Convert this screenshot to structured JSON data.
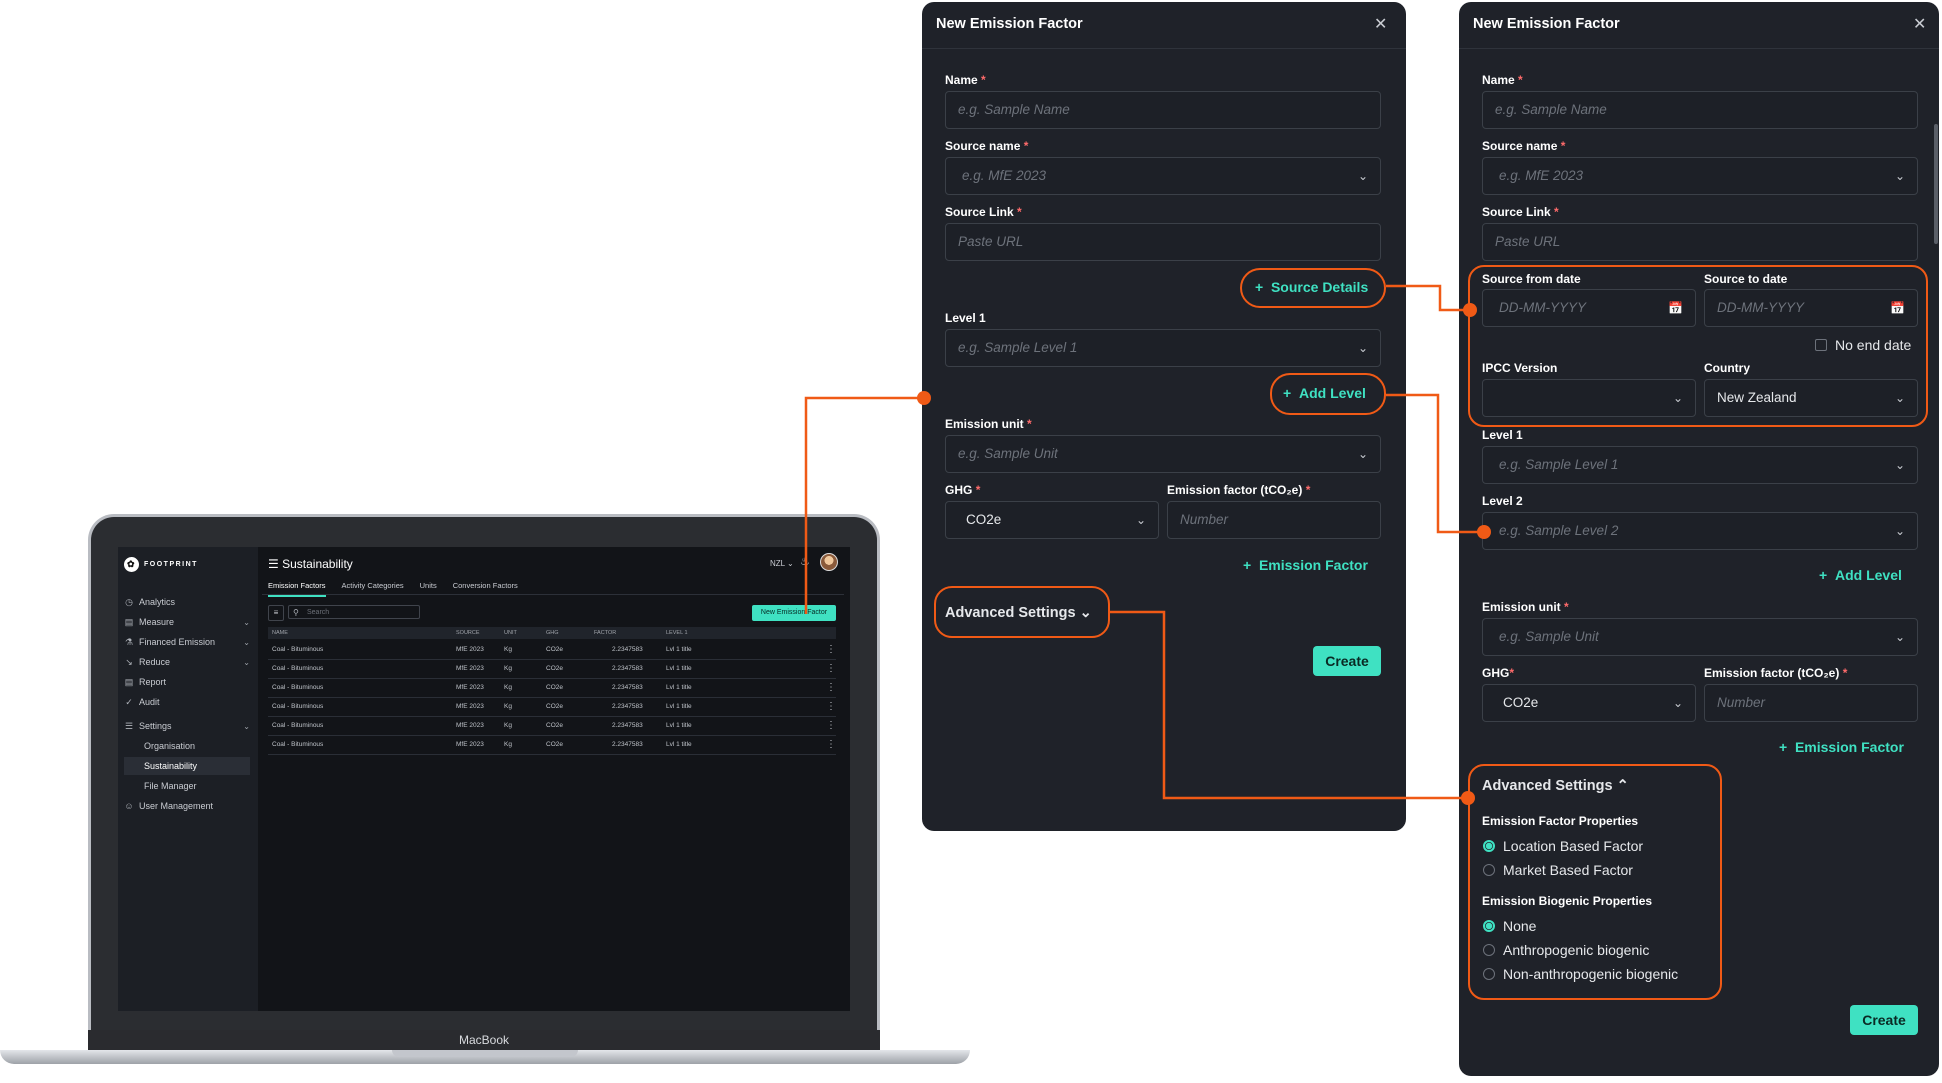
{
  "laptop": {
    "device_label": "MacBook",
    "app": {
      "brand": "FOOTPRINT",
      "page_title": "Sustainability",
      "region": "NZL",
      "nav": [
        {
          "label": "Analytics",
          "icon": "analytics-icon"
        },
        {
          "label": "Measure",
          "icon": "measure-icon"
        },
        {
          "label": "Financed Emission",
          "icon": "bank-icon"
        },
        {
          "label": "Reduce",
          "icon": "reduce-icon"
        },
        {
          "label": "Report",
          "icon": "report-icon"
        },
        {
          "label": "Audit",
          "icon": "audit-icon"
        },
        {
          "label": "Settings",
          "icon": "sliders-icon"
        }
      ],
      "settings_sub": [
        "Organisation",
        "Sustainability",
        "File Manager"
      ],
      "user_management": "User Management",
      "tabs": [
        "Emission Factors",
        "Activity Categories",
        "Units",
        "Conversion Factors"
      ],
      "search_placeholder": "Search",
      "new_button": "New Emission Factor",
      "columns": [
        "NAME",
        "SOURCE",
        "UNIT",
        "GHG",
        "FACTOR",
        "LEVEL 1"
      ],
      "rows": [
        [
          "Coal - Bituminous",
          "MfE 2023",
          "Kg",
          "CO2e",
          "2.2347583",
          "Lvl 1 title"
        ],
        [
          "Coal - Bituminous",
          "MfE 2023",
          "Kg",
          "CO2e",
          "2.2347583",
          "Lvl 1 title"
        ],
        [
          "Coal - Bituminous",
          "MfE 2023",
          "Kg",
          "CO2e",
          "2.2347583",
          "Lvl 1 title"
        ],
        [
          "Coal - Bituminous",
          "MfE 2023",
          "Kg",
          "CO2e",
          "2.2347583",
          "Lvl 1 title"
        ],
        [
          "Coal - Bituminous",
          "MfE 2023",
          "Kg",
          "CO2e",
          "2.2347583",
          "Lvl 1 title"
        ],
        [
          "Coal - Bituminous",
          "MfE 2023",
          "Kg",
          "CO2e",
          "2.2347583",
          "Lvl 1 title"
        ]
      ]
    }
  },
  "panel1": {
    "title": "New Emission Factor",
    "name_label": "Name",
    "name_placeholder": "e.g. Sample Name",
    "source_name_label": "Source name",
    "source_name_placeholder": "e.g. MfE 2023",
    "source_link_label": "Source Link",
    "source_link_placeholder": "Paste URL",
    "source_details": "Source Details",
    "level1_label": "Level 1",
    "level1_placeholder": "e.g. Sample Level 1",
    "add_level": "Add Level",
    "emission_unit_label": "Emission unit",
    "emission_unit_placeholder": "e.g. Sample Unit",
    "ghg_label": "GHG",
    "ghg_value": "CO2e",
    "factor_label": "Emission factor (tCO₂e)",
    "factor_placeholder": "Number",
    "add_factor": "Emission Factor",
    "advanced": "Advanced Settings",
    "create": "Create"
  },
  "panel2": {
    "title": "New Emission Factor",
    "name_label": "Name",
    "name_placeholder": "e.g. Sample Name",
    "source_name_label": "Source name",
    "source_name_placeholder": "e.g. MfE 2023",
    "source_link_label": "Source Link",
    "source_link_placeholder": "Paste URL",
    "from_label": "Source from date",
    "to_label": "Source to date",
    "date_placeholder": "DD-MM-YYYY",
    "no_end_date": "No end date",
    "ipcc_label": "IPCC Version",
    "country_label": "Country",
    "country_value": "New Zealand",
    "level1_label": "Level 1",
    "level1_placeholder": "e.g. Sample Level 1",
    "level2_label": "Level 2",
    "level2_placeholder": "e.g. Sample Level 2",
    "add_level": "Add Level",
    "emission_unit_label": "Emission unit",
    "emission_unit_placeholder": "e.g. Sample Unit",
    "ghg_label": "GHG",
    "ghg_value": "CO2e",
    "factor_label": "Emission factor (tCO₂e)",
    "factor_placeholder": "Number",
    "add_factor": "Emission Factor",
    "advanced": "Advanced Settings",
    "ef_props_label": "Emission Factor Properties",
    "ef_props": [
      "Location Based Factor",
      "Market Based Factor"
    ],
    "bio_label": "Emission Biogenic Properties",
    "bio_props": [
      "None",
      "Anthropogenic biogenic",
      "Non-anthropogenic biogenic"
    ],
    "create": "Create"
  },
  "colors": {
    "accent": "#3fe1c2",
    "callout": "#f05a16",
    "panel_bg": "#1f2229"
  }
}
